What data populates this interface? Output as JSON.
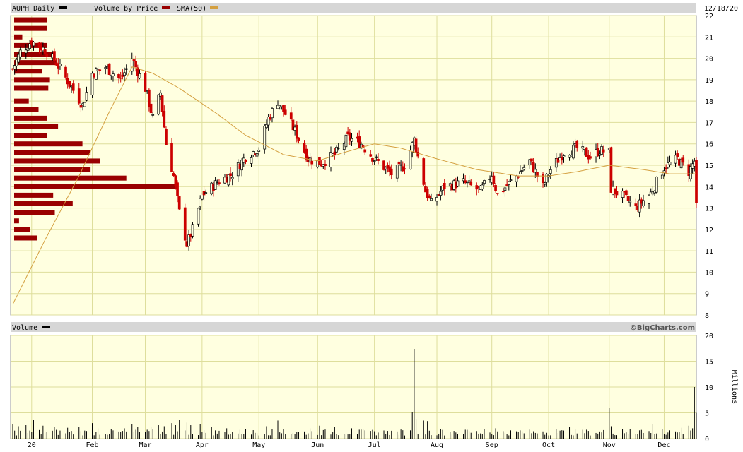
{
  "header": {
    "title": "AUPH Daily",
    "legend_vbp": "Volume by Price",
    "legend_sma": "SMA(50)",
    "date": "12/18/20",
    "volume_label": "Volume",
    "brand": "©BigCharts.com",
    "millions": "Millions"
  },
  "colors": {
    "panel_bg": "#ffffe0",
    "grid": "#dede9c",
    "up_candle": "#000000",
    "down_candle": "#cc0000",
    "vbp": "#990000",
    "sma": "#d4a040",
    "header_bg": "#d6d6d6"
  },
  "chart_data": [
    {
      "type": "candlestick",
      "title": "AUPH Daily",
      "y_ticks": [
        8,
        9,
        10,
        11,
        12,
        13,
        14,
        15,
        16,
        17,
        18,
        19,
        20,
        21,
        22
      ],
      "ylim": [
        8,
        22
      ],
      "x_tick_labels": [
        "20",
        "Feb",
        "Mar",
        "Apr",
        "May",
        "Jun",
        "Jul",
        "Aug",
        "Sep",
        "Oct",
        "Nov",
        "Dec"
      ],
      "x_tick_dates": [
        "2020-01-02",
        "2020-02-03",
        "2020-03-02",
        "2020-04-01",
        "2020-05-01",
        "2020-06-01",
        "2020-07-01",
        "2020-08-03",
        "2020-09-01",
        "2020-10-01",
        "2020-11-02",
        "2020-12-01"
      ],
      "xlim": [
        "2019-12-23",
        "2020-12-18"
      ],
      "price_anchors": [
        [
          "2019-12-23",
          19.5
        ],
        [
          "2019-12-27",
          20.3
        ],
        [
          "2020-01-02",
          20.8
        ],
        [
          "2020-01-09",
          20.4
        ],
        [
          "2020-01-15",
          19.8
        ],
        [
          "2020-01-22",
          18.8
        ],
        [
          "2020-01-29",
          17.8
        ],
        [
          "2020-02-03",
          19.3
        ],
        [
          "2020-02-10",
          19.6
        ],
        [
          "2020-02-18",
          19.0
        ],
        [
          "2020-02-24",
          20.0
        ],
        [
          "2020-03-02",
          18.6
        ],
        [
          "2020-03-06",
          17.2
        ],
        [
          "2020-03-10",
          18.4
        ],
        [
          "2020-03-13",
          16.0
        ],
        [
          "2020-03-17",
          14.5
        ],
        [
          "2020-03-20",
          12.8
        ],
        [
          "2020-03-24",
          11.3
        ],
        [
          "2020-03-27",
          12.0
        ],
        [
          "2020-04-01",
          13.6
        ],
        [
          "2020-04-09",
          14.2
        ],
        [
          "2020-04-17",
          14.6
        ],
        [
          "2020-04-24",
          15.4
        ],
        [
          "2020-05-01",
          15.8
        ],
        [
          "2020-05-06",
          17.2
        ],
        [
          "2020-05-11",
          18.0
        ],
        [
          "2020-05-15",
          17.4
        ],
        [
          "2020-05-20",
          16.6
        ],
        [
          "2020-05-27",
          15.3
        ],
        [
          "2020-06-03",
          15.1
        ],
        [
          "2020-06-10",
          15.5
        ],
        [
          "2020-06-17",
          16.3
        ],
        [
          "2020-06-24",
          16.0
        ],
        [
          "2020-07-01",
          15.3
        ],
        [
          "2020-07-10",
          14.6
        ],
        [
          "2020-07-17",
          15.0
        ],
        [
          "2020-07-22",
          16.2
        ],
        [
          "2020-07-28",
          13.8
        ],
        [
          "2020-07-31",
          13.2
        ],
        [
          "2020-08-07",
          14.0
        ],
        [
          "2020-08-17",
          14.2
        ],
        [
          "2020-08-26",
          13.8
        ],
        [
          "2020-09-01",
          14.6
        ],
        [
          "2020-09-04",
          13.6
        ],
        [
          "2020-09-14",
          14.5
        ],
        [
          "2020-09-21",
          15.2
        ],
        [
          "2020-09-28",
          14.0
        ],
        [
          "2020-10-02",
          14.8
        ],
        [
          "2020-10-09",
          15.6
        ],
        [
          "2020-10-16",
          15.8
        ],
        [
          "2020-10-23",
          15.4
        ],
        [
          "2020-10-28",
          15.7
        ],
        [
          "2020-11-02",
          15.6
        ],
        [
          "2020-11-03",
          13.9
        ],
        [
          "2020-11-10",
          13.5
        ],
        [
          "2020-11-16",
          13.0
        ],
        [
          "2020-11-24",
          13.7
        ],
        [
          "2020-12-01",
          14.9
        ],
        [
          "2020-12-08",
          15.3
        ],
        [
          "2020-12-14",
          14.7
        ],
        [
          "2020-12-17",
          15.2
        ],
        [
          "2020-12-18",
          13.0
        ]
      ],
      "sma_anchors": [
        [
          "2019-12-23",
          8.5
        ],
        [
          "2020-01-09",
          11.5
        ],
        [
          "2020-01-27",
          14.5
        ],
        [
          "2020-02-12",
          17.5
        ],
        [
          "2020-02-24",
          19.6
        ],
        [
          "2020-03-06",
          19.3
        ],
        [
          "2020-03-20",
          18.6
        ],
        [
          "2020-04-09",
          17.4
        ],
        [
          "2020-04-24",
          16.4
        ],
        [
          "2020-05-14",
          15.5
        ],
        [
          "2020-06-01",
          15.2
        ],
        [
          "2020-06-15",
          15.6
        ],
        [
          "2020-07-01",
          16.0
        ],
        [
          "2020-07-15",
          15.8
        ],
        [
          "2020-08-03",
          15.3
        ],
        [
          "2020-08-24",
          14.8
        ],
        [
          "2020-09-15",
          14.5
        ],
        [
          "2020-10-01",
          14.5
        ],
        [
          "2020-10-16",
          14.7
        ],
        [
          "2020-11-02",
          15.0
        ],
        [
          "2020-11-20",
          14.8
        ],
        [
          "2020-12-04",
          14.6
        ],
        [
          "2020-12-18",
          14.6
        ]
      ],
      "volume_by_price": [
        {
          "price": 21.8,
          "volume": 20
        },
        {
          "price": 21.4,
          "volume": 20
        },
        {
          "price": 21.0,
          "volume": 5
        },
        {
          "price": 20.6,
          "volume": 20
        },
        {
          "price": 20.2,
          "volume": 24
        },
        {
          "price": 19.8,
          "volume": 26
        },
        {
          "price": 19.4,
          "volume": 17
        },
        {
          "price": 19.0,
          "volume": 22
        },
        {
          "price": 18.6,
          "volume": 21
        },
        {
          "price": 18.0,
          "volume": 9
        },
        {
          "price": 17.6,
          "volume": 15
        },
        {
          "price": 17.2,
          "volume": 20
        },
        {
          "price": 16.8,
          "volume": 27
        },
        {
          "price": 16.4,
          "volume": 20
        },
        {
          "price": 16.0,
          "volume": 42
        },
        {
          "price": 15.6,
          "volume": 47
        },
        {
          "price": 15.2,
          "volume": 53
        },
        {
          "price": 14.8,
          "volume": 47
        },
        {
          "price": 14.4,
          "volume": 69
        },
        {
          "price": 14.0,
          "volume": 100
        },
        {
          "price": 13.6,
          "volume": 24
        },
        {
          "price": 13.2,
          "volume": 36
        },
        {
          "price": 12.8,
          "volume": 25
        },
        {
          "price": 12.4,
          "volume": 3
        },
        {
          "price": 12.0,
          "volume": 10
        },
        {
          "price": 11.6,
          "volume": 14
        }
      ]
    },
    {
      "type": "bar",
      "title": "Volume",
      "ylabel": "Millions",
      "y_ticks": [
        0,
        5,
        10,
        15,
        20
      ],
      "ylim": [
        0,
        20
      ],
      "base_volume": 1.2,
      "volume_spikes": [
        [
          "2019-12-23",
          2.8
        ],
        [
          "2019-12-26",
          2.4
        ],
        [
          "2019-12-30",
          2.6
        ],
        [
          "2020-01-03",
          3.6
        ],
        [
          "2020-01-08",
          2.5
        ],
        [
          "2020-01-14",
          2.2
        ],
        [
          "2020-01-21",
          2.1
        ],
        [
          "2020-01-27",
          2.2
        ],
        [
          "2020-02-03",
          3.0
        ],
        [
          "2020-02-06",
          2.0
        ],
        [
          "2020-02-14",
          1.6
        ],
        [
          "2020-02-20",
          2.0
        ],
        [
          "2020-02-24",
          2.8
        ],
        [
          "2020-02-27",
          2.3
        ],
        [
          "2020-03-05",
          2.2
        ],
        [
          "2020-03-09",
          2.6
        ],
        [
          "2020-03-12",
          2.4
        ],
        [
          "2020-03-16",
          3.0
        ],
        [
          "2020-03-18",
          2.6
        ],
        [
          "2020-03-20",
          3.6
        ],
        [
          "2020-03-24",
          3.1
        ],
        [
          "2020-03-26",
          2.6
        ],
        [
          "2020-03-31",
          2.8
        ],
        [
          "2020-04-06",
          2.2
        ],
        [
          "2020-04-14",
          2.0
        ],
        [
          "2020-04-24",
          1.8
        ],
        [
          "2020-05-05",
          2.4
        ],
        [
          "2020-05-11",
          3.5
        ],
        [
          "2020-05-14",
          1.8
        ],
        [
          "2020-05-28",
          2.0
        ],
        [
          "2020-06-02",
          2.5
        ],
        [
          "2020-06-10",
          2.2
        ],
        [
          "2020-06-19",
          2.0
        ],
        [
          "2020-06-26",
          1.6
        ],
        [
          "2020-07-08",
          1.5
        ],
        [
          "2020-07-21",
          5.2
        ],
        [
          "2020-07-22",
          17.4
        ],
        [
          "2020-07-23",
          3.8
        ],
        [
          "2020-07-27",
          3.5
        ],
        [
          "2020-07-29",
          3.4
        ],
        [
          "2020-08-05",
          1.8
        ],
        [
          "2020-08-12",
          1.5
        ],
        [
          "2020-08-19",
          1.7
        ],
        [
          "2020-08-28",
          1.8
        ],
        [
          "2020-09-03",
          2.0
        ],
        [
          "2020-09-16",
          1.6
        ],
        [
          "2020-09-28",
          1.4
        ],
        [
          "2020-10-05",
          1.8
        ],
        [
          "2020-10-12",
          2.2
        ],
        [
          "2020-10-22",
          1.5
        ],
        [
          "2020-11-02",
          5.9
        ],
        [
          "2020-11-03",
          2.4
        ],
        [
          "2020-11-09",
          1.8
        ],
        [
          "2020-11-13",
          1.8
        ],
        [
          "2020-11-18",
          1.6
        ],
        [
          "2020-11-25",
          2.8
        ],
        [
          "2020-11-30",
          1.9
        ],
        [
          "2020-12-04",
          1.6
        ],
        [
          "2020-12-10",
          2.1
        ],
        [
          "2020-12-14",
          2.5
        ],
        [
          "2020-12-16",
          2.0
        ],
        [
          "2020-12-17",
          10.0
        ],
        [
          "2020-12-18",
          5.0
        ]
      ]
    }
  ]
}
